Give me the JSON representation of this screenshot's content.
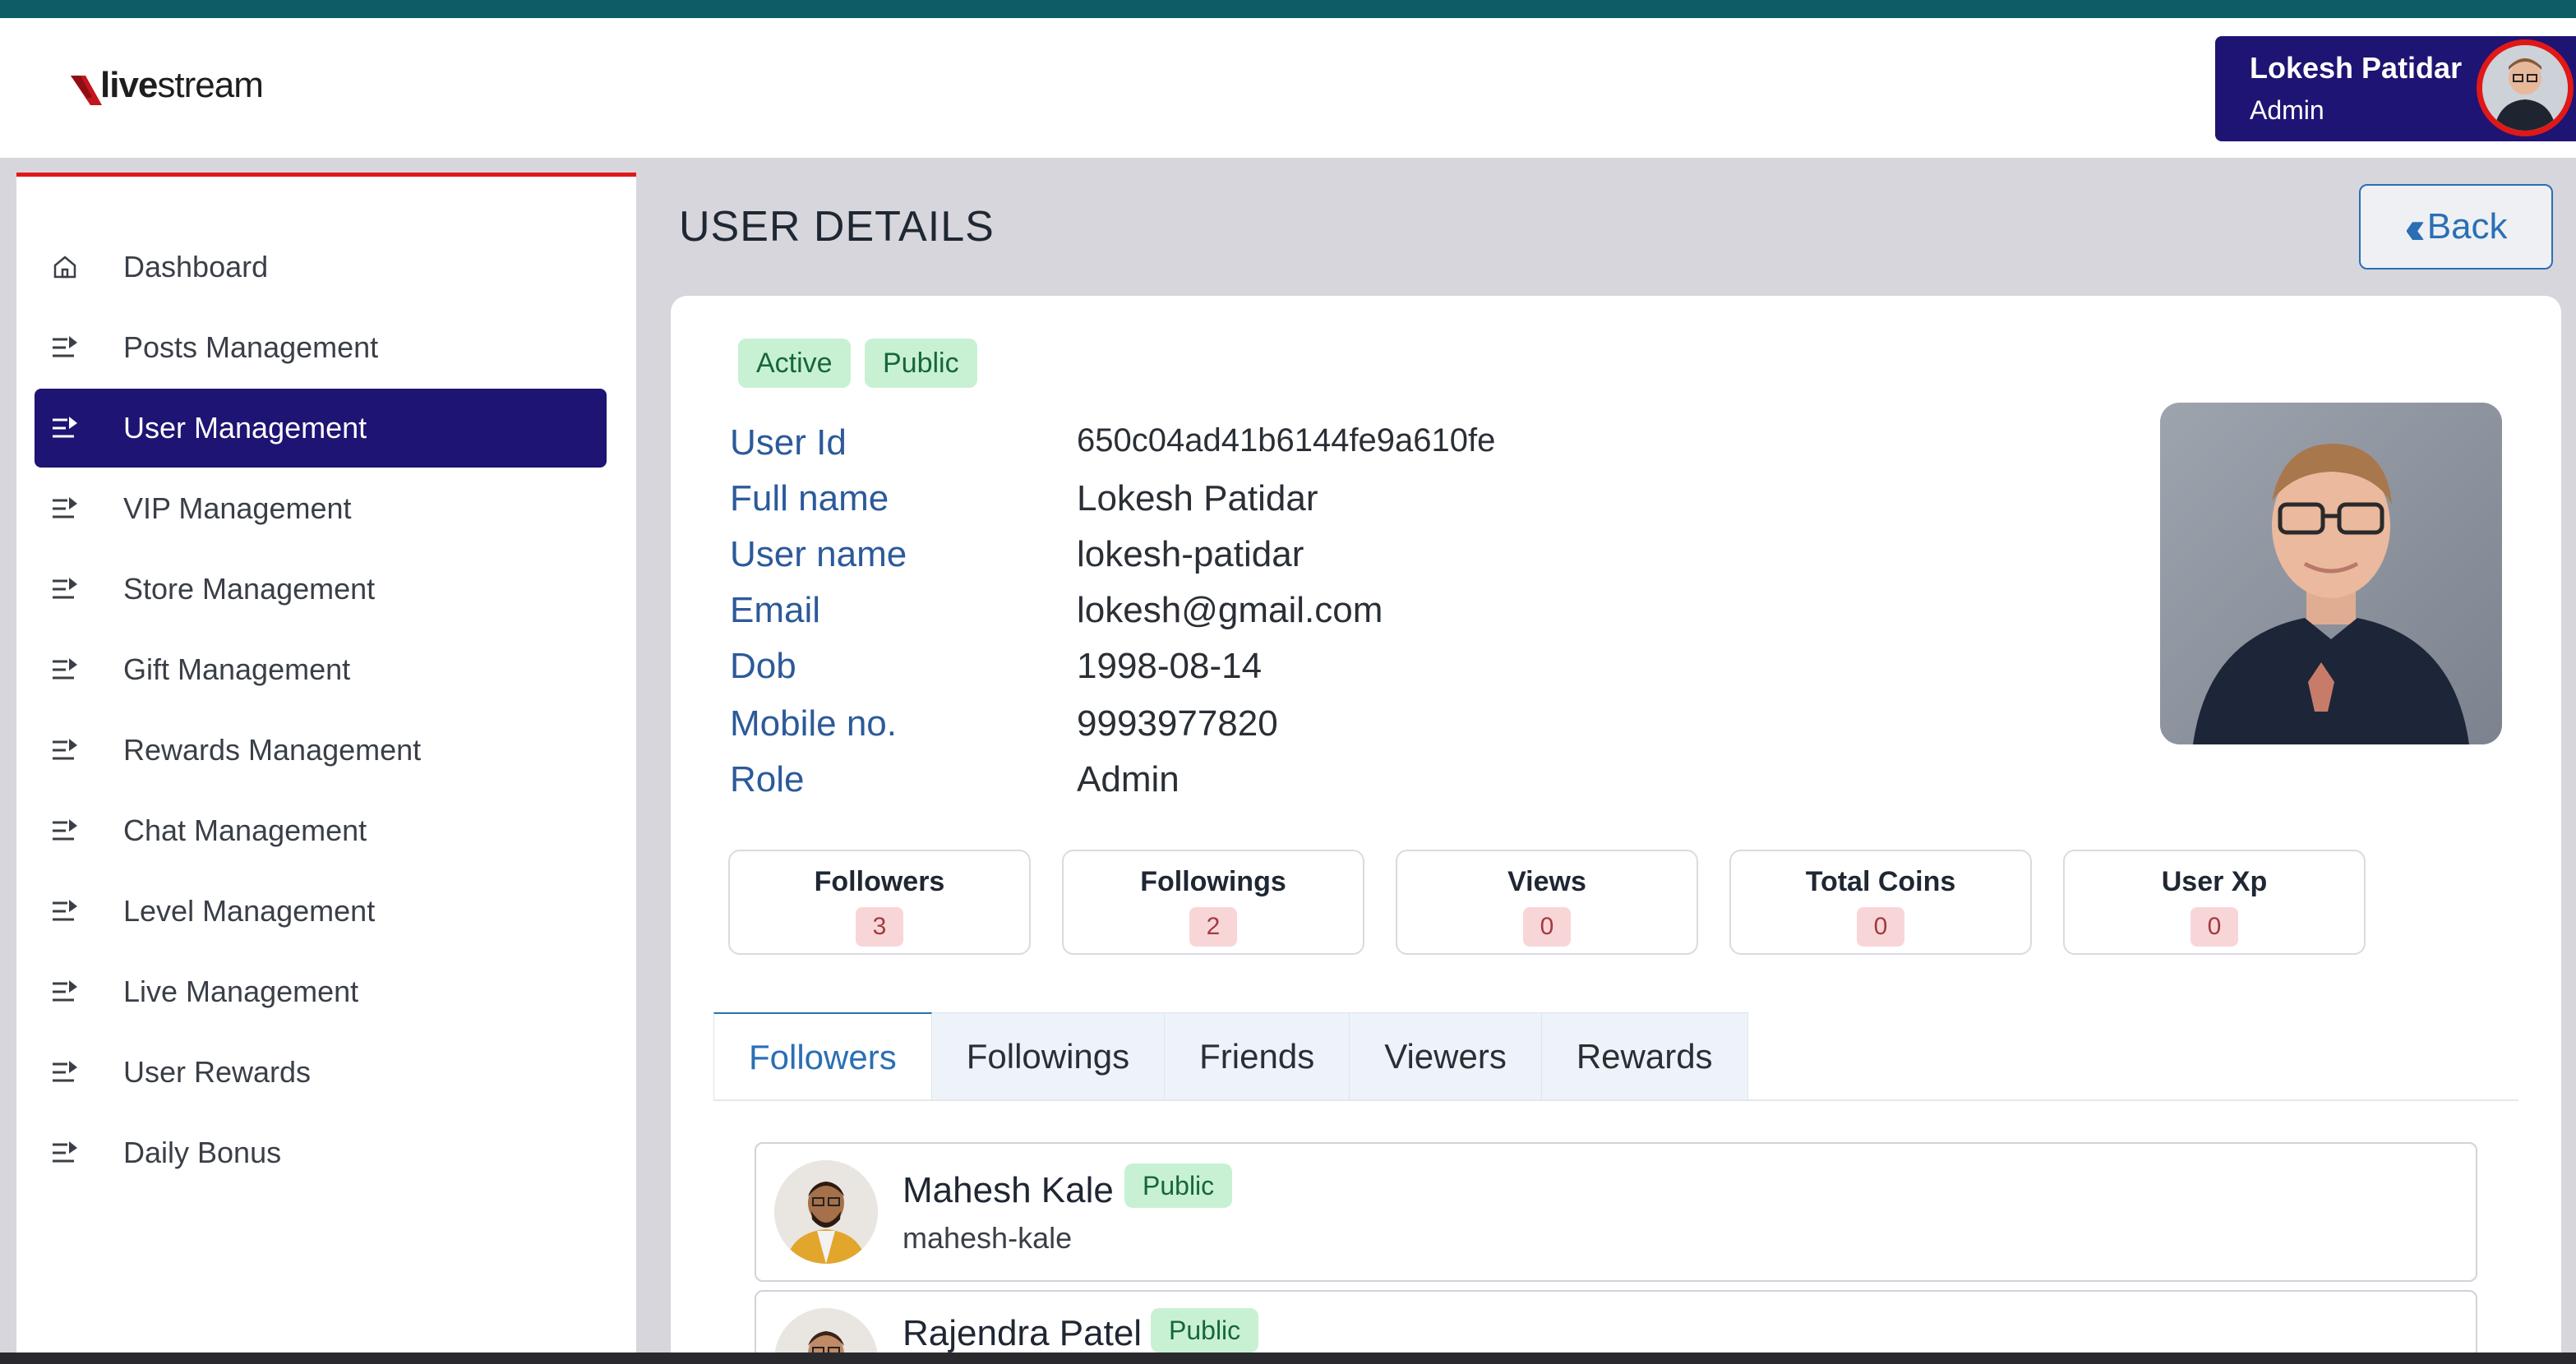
{
  "brand": {
    "logo_text_bold": "live",
    "logo_text": "stream"
  },
  "current_user": {
    "name": "Lokesh Patidar",
    "role": "Admin"
  },
  "sidebar": {
    "items": [
      {
        "label": "Dashboard",
        "icon": "home-icon"
      },
      {
        "label": "Posts Management",
        "icon": "list-arrow-icon"
      },
      {
        "label": "User Management",
        "icon": "list-arrow-icon",
        "active": true
      },
      {
        "label": "VIP Management",
        "icon": "list-arrow-icon"
      },
      {
        "label": "Store Management",
        "icon": "list-arrow-icon"
      },
      {
        "label": "Gift Management",
        "icon": "list-arrow-icon"
      },
      {
        "label": "Rewards Management",
        "icon": "list-arrow-icon"
      },
      {
        "label": "Chat Management",
        "icon": "list-arrow-icon"
      },
      {
        "label": "Level Management",
        "icon": "list-arrow-icon"
      },
      {
        "label": "Live Management",
        "icon": "list-arrow-icon"
      },
      {
        "label": "User Rewards",
        "icon": "list-arrow-icon"
      },
      {
        "label": "Daily Bonus",
        "icon": "list-arrow-icon"
      }
    ]
  },
  "page": {
    "title": "USER DETAILS",
    "back_label": "Back"
  },
  "user": {
    "badges": [
      "Active",
      "Public"
    ],
    "fields": [
      {
        "label": "User Id",
        "value": "650c04ad41b6144fe9a610fe"
      },
      {
        "label": "Full name",
        "value": "Lokesh Patidar"
      },
      {
        "label": "User name",
        "value": "lokesh-patidar"
      },
      {
        "label": "Email",
        "value": "lokesh@gmail.com"
      },
      {
        "label": "Dob",
        "value": "1998-08-14"
      },
      {
        "label": "Mobile no.",
        "value": "9993977820"
      },
      {
        "label": "Role",
        "value": "Admin"
      }
    ]
  },
  "stats": [
    {
      "label": "Followers",
      "value": "3"
    },
    {
      "label": "Followings",
      "value": "2"
    },
    {
      "label": "Views",
      "value": "0"
    },
    {
      "label": "Total Coins",
      "value": "0"
    },
    {
      "label": "User Xp",
      "value": "0"
    }
  ],
  "tabs": [
    {
      "label": "Followers",
      "active": true
    },
    {
      "label": "Followings"
    },
    {
      "label": "Friends"
    },
    {
      "label": "Viewers"
    },
    {
      "label": "Rewards"
    }
  ],
  "followers": [
    {
      "name": "Mahesh Kale",
      "username": "mahesh-kale",
      "badge": "Public"
    },
    {
      "name": "Rajendra Patel",
      "username": "",
      "badge": "Public"
    }
  ],
  "colors": {
    "primary": "#1e1473",
    "accent_red": "#e01818",
    "label_blue": "#2c5a9a",
    "badge_green_bg": "#c8f1d4",
    "stat_badge_bg": "#f8d6d8",
    "top_strip": "#0d5d66"
  }
}
